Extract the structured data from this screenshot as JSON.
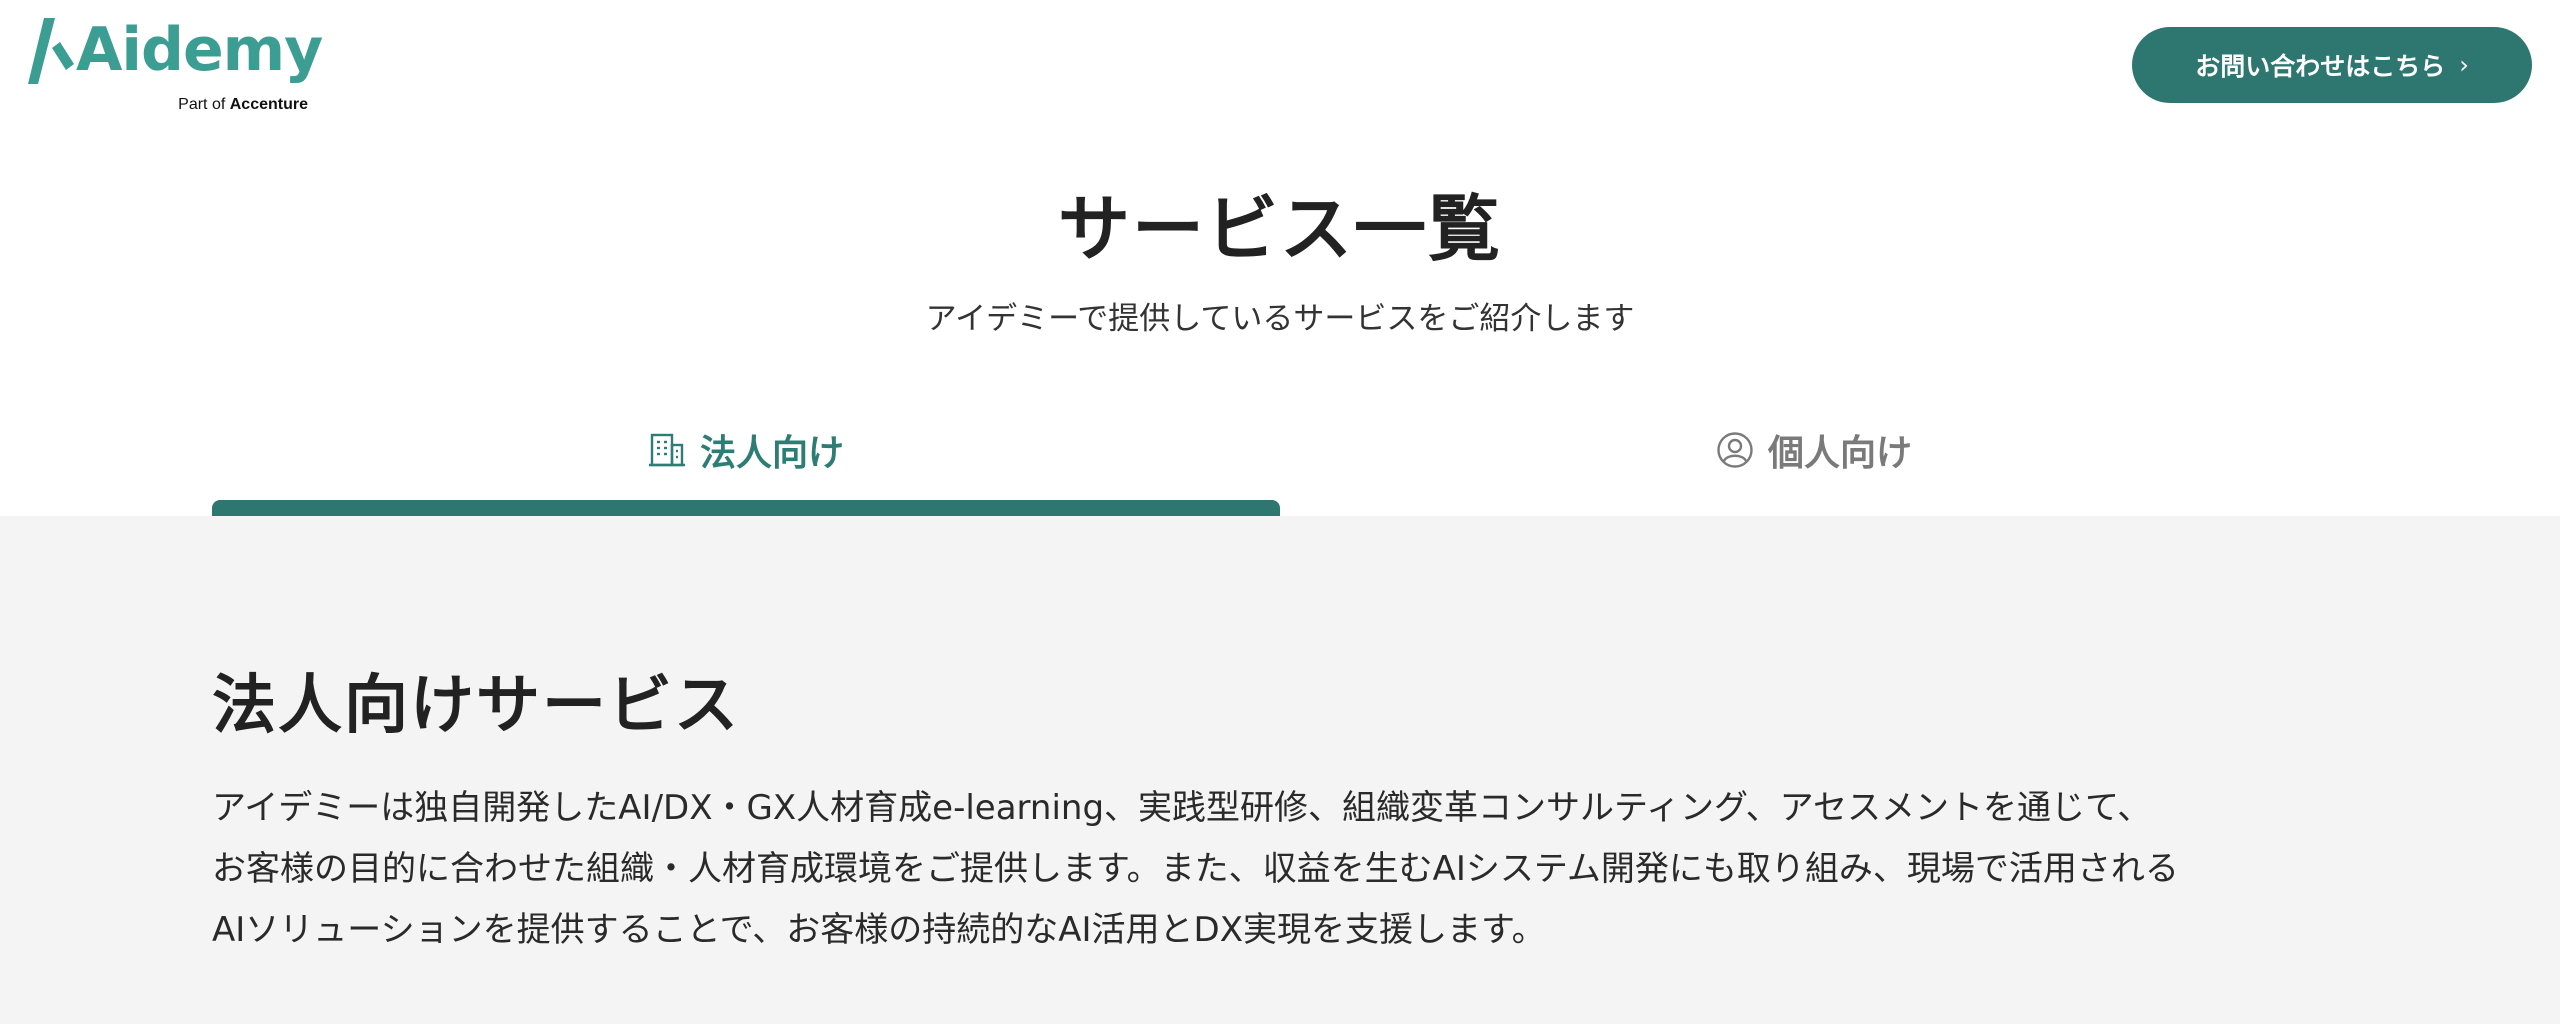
{
  "header": {
    "logo_text": "Aidemy",
    "logo_sub_prefix": "Part of",
    "logo_sub_brand": "Accenture",
    "contact_label": "お問い合わせはこちら",
    "contact_chevron": "›"
  },
  "hero": {
    "title": "サービス一覧",
    "subtitle": "アイデミーで提供しているサービスをご紹介します"
  },
  "tabs": [
    {
      "label": "法人向け",
      "icon": "building-icon",
      "active": true
    },
    {
      "label": "個人向け",
      "icon": "user-circle-icon",
      "active": false
    }
  ],
  "section": {
    "title": "法人向けサービス",
    "desc_lines": [
      "アイデミーは独自開発したAI/DX・GX人材育成e-learning、実践型研修、組織変革コンサルティング、アセスメントを通じて、",
      "お客様の目的に合わせた組織・人材育成環境をご提供します。また、収益を生むAIシステム開発にも取り組み、現場で活用される",
      "AIソリューションを提供することで、お客様の持続的なAI活用とDX実現を支援します。"
    ]
  },
  "colors": {
    "brand": "#3c9d93",
    "accent_dark": "#2e7770",
    "tab_active_text": "#2e7d74",
    "tab_inactive_text": "#7a7a7a",
    "section_bg": "#f4f4f4"
  }
}
